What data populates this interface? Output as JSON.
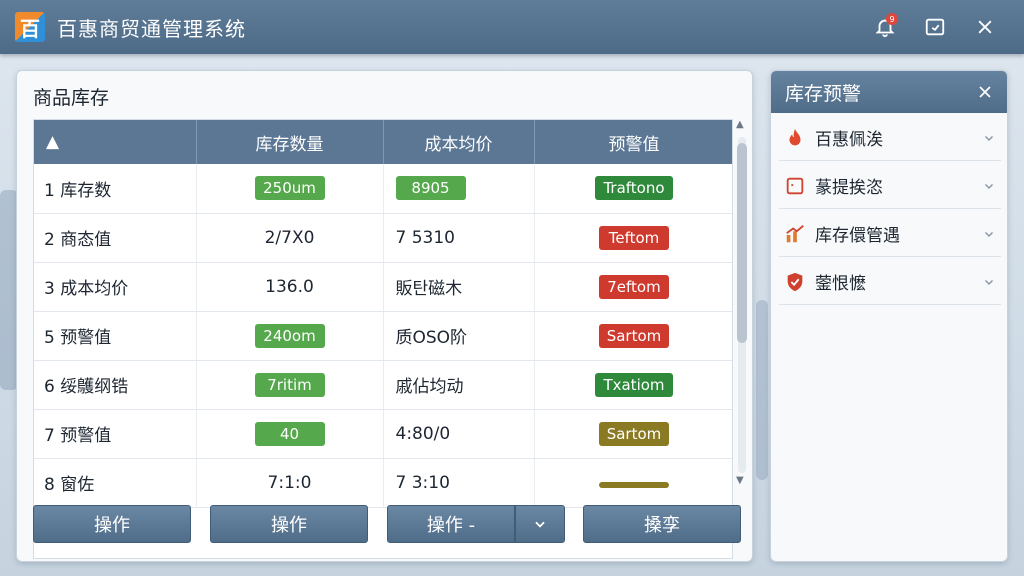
{
  "app": {
    "title": "百惠商贸通管理系统",
    "logo_text": "百",
    "notification_count": "9"
  },
  "main": {
    "title": "商品库存",
    "columns": [
      "▲",
      "库存数量",
      "成本均价",
      "预警值"
    ],
    "rows": [
      {
        "name": "1  库存数",
        "qty": "250um",
        "qty_color": "#55a84b",
        "cost": "8905",
        "cost_color": "#55a84b",
        "warn": "Traftono",
        "warn_color": "#2e8a3a"
      },
      {
        "name": "2  商态值",
        "qty": "2/7X0",
        "qty_color": "",
        "cost": "7  5310",
        "cost_color": "",
        "warn": "Teftom",
        "warn_color": "#cf3a2f"
      },
      {
        "name": "3  成本均价",
        "qty": "136.0",
        "qty_color": "",
        "cost": "販탄磁木",
        "cost_color": "",
        "warn": "7eftom",
        "warn_color": "#cf3a2f"
      },
      {
        "name": "5  预警值",
        "qty": "240om",
        "qty_color": "#55a84b",
        "cost": "质OSO阶",
        "cost_color": "",
        "warn": "Sartom",
        "warn_color": "#cf3a2f"
      },
      {
        "name": "6  绥鸌纲锆",
        "qty": "7ritim",
        "qty_color": "#55a84b",
        "cost": "戚佔均动",
        "cost_color": "",
        "warn": "Txatiom",
        "warn_color": "#2e8a3a"
      },
      {
        "name": "7  预警值",
        "qty": "40",
        "qty_color": "#55a84b",
        "cost": "4:80/0",
        "cost_color": "",
        "warn": "Sartom",
        "warn_color": "#8b7a24"
      },
      {
        "name": "8  窗佐",
        "qty": "7:1:0",
        "qty_color": "",
        "cost": "7  3:10",
        "cost_color": "",
        "warn": "",
        "warn_color": "#8b7a24"
      }
    ],
    "buttons": [
      "操作",
      "操作",
      "操作 -",
      "搡孪"
    ]
  },
  "side": {
    "title": "库存预警",
    "items": [
      {
        "label": "百惠佩涘",
        "icon": "fire-icon"
      },
      {
        "label": "蒃提挨恣",
        "icon": "calendar-icon"
      },
      {
        "label": "库存儇管遇",
        "icon": "chart-icon"
      },
      {
        "label": "蓥恨懡",
        "icon": "shield-icon"
      }
    ]
  },
  "colors": {
    "header": "#5b7794",
    "accent_red": "#cf3a2f",
    "accent_green": "#55a84b"
  }
}
